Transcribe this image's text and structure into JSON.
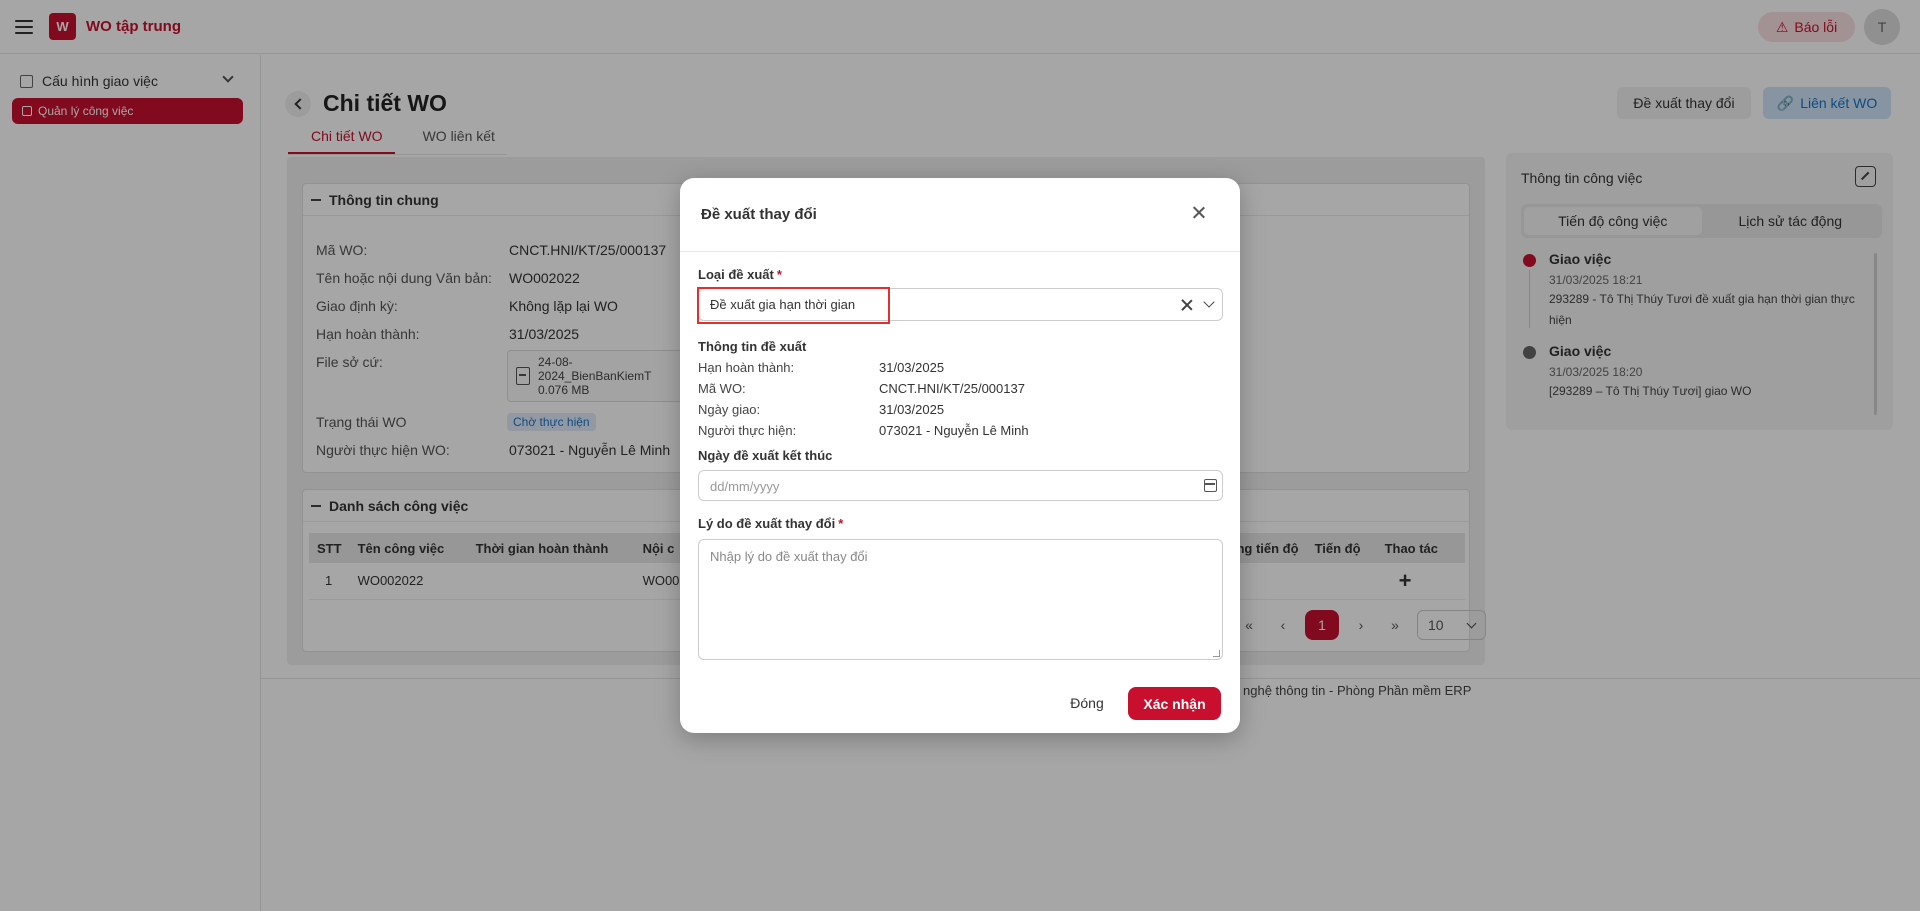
{
  "app": {
    "title": "WO tập trung",
    "report_label": "Báo lỗi",
    "avatar_initial": "T"
  },
  "sidebar": {
    "group_label": "Cấu hình giao việc",
    "active_item": "Quản lý công việc"
  },
  "page": {
    "title": "Chi tiết WO",
    "tabs": [
      "Chi tiết WO",
      "WO liên kết"
    ],
    "actions": {
      "suggest_change": "Đề xuất thay đổi",
      "link_wo": "Liên kết WO"
    }
  },
  "general_info": {
    "header": "Thông tin chung",
    "rows": [
      {
        "label": "Mã WO:",
        "value": "CNCT.HNI/KT/25/000137"
      },
      {
        "label": "Tên hoặc nội dung Văn bản:",
        "value": "WO002022"
      },
      {
        "label": "Giao định kỳ:",
        "value": "Không lặp lại WO"
      },
      {
        "label": "Hạn hoàn thành:",
        "value": "31/03/2025"
      }
    ],
    "file_label": "File sở cứ:",
    "file_name": "24-08-2024_BienBanKiemT",
    "file_size": "0.076 MB",
    "status_label": "Trạng thái WO",
    "status_value": "Chờ thực hiện",
    "assignee_label": "Người thực hiện WO:",
    "assignee_value": "073021 - Nguyễn Lê Minh"
  },
  "task_list": {
    "header": "Danh sách công việc",
    "columns": [
      "STT",
      "Tên công việc",
      "Thời gian hoàn thành",
      "Nội c",
      "ng tiến độ",
      "Tiến độ",
      "Thao tác"
    ],
    "rows": [
      {
        "stt": "1",
        "name": "WO002022",
        "time": "",
        "content": "WO002"
      }
    ]
  },
  "pagination": {
    "first": "«",
    "prev": "‹",
    "current": "1",
    "next": "›",
    "last": "»",
    "page_size": "10"
  },
  "footer": {
    "text": "nghệ thông tin - Phòng Phần mềm ERP"
  },
  "right_panel": {
    "title": "Thông tin công việc",
    "tabs": [
      "Tiến độ công việc",
      "Lịch sử tác động"
    ],
    "timeline": [
      {
        "title": "Giao việc",
        "time": "31/03/2025 18:21",
        "desc": "293289 - Tô Thị Thúy Tươi đề xuất gia hạn thời gian thực hiện",
        "color": "#c8102e"
      },
      {
        "title": "Giao việc",
        "time": "31/03/2025 18:20",
        "desc": "[293289 – Tô Thị Thúy Tươi] giao WO",
        "color": "#666666"
      }
    ]
  },
  "modal": {
    "title": "Đề xuất thay đổi",
    "type_label": "Loại đề xuất",
    "type_value": "Đề xuất gia hạn thời gian",
    "info_title": "Thông tin đề xuất",
    "info_rows": [
      {
        "label": "Hạn hoàn thành:",
        "value": "31/03/2025"
      },
      {
        "label": "Mã WO:",
        "value": "CNCT.HNI/KT/25/000137"
      },
      {
        "label": "Ngày giao:",
        "value": "31/03/2025"
      },
      {
        "label": "Người thực hiện:",
        "value": "073021 - Nguyễn Lê Minh"
      }
    ],
    "end_date_label": "Ngày đề xuất kết thúc",
    "end_date_placeholder": "dd/mm/yyyy",
    "reason_label": "Lý do đề xuất thay đổi",
    "reason_placeholder": "Nhập lý do đề xuất thay đổi",
    "close_label": "Đóng",
    "confirm_label": "Xác nhận"
  },
  "colors": {
    "brand": "#c8102e",
    "link": "#1a73c9",
    "overlay": "rgba(0,0,0,0.35)"
  }
}
